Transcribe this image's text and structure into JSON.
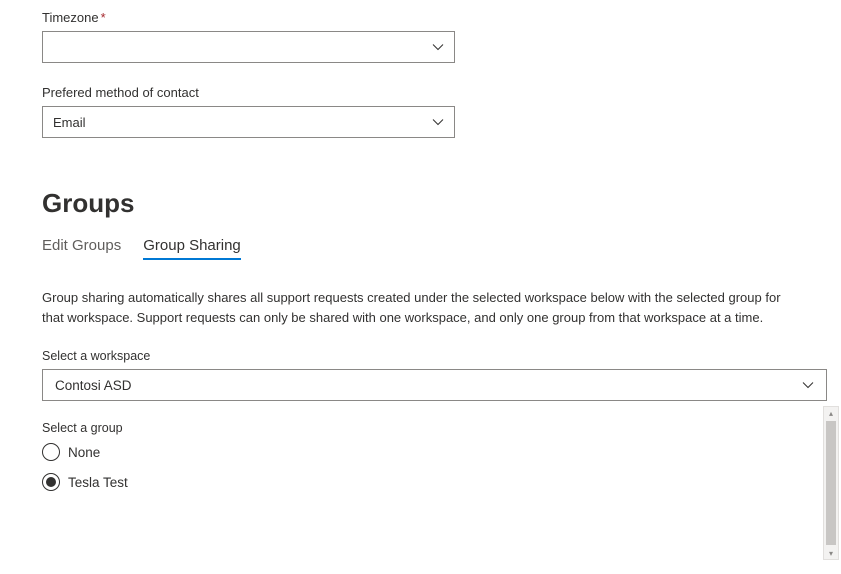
{
  "fields": {
    "timezone": {
      "label": "Timezone",
      "required": true,
      "value": ""
    },
    "contact_method": {
      "label": "Prefered method of contact",
      "value": "Email"
    }
  },
  "section": {
    "title": "Groups"
  },
  "tabs": {
    "edit": "Edit Groups",
    "sharing": "Group Sharing"
  },
  "sharing": {
    "description": "Group sharing automatically shares all support requests created under the selected workspace below with the selected group for that workspace. Support requests can only be shared with one workspace, and only one group from that workspace at a time.",
    "workspace_label": "Select a workspace",
    "workspace_value": "Contosi ASD",
    "group_label": "Select a group",
    "groups": {
      "none": "None",
      "tesla": "Tesla Test"
    },
    "selected_group": "tesla"
  }
}
